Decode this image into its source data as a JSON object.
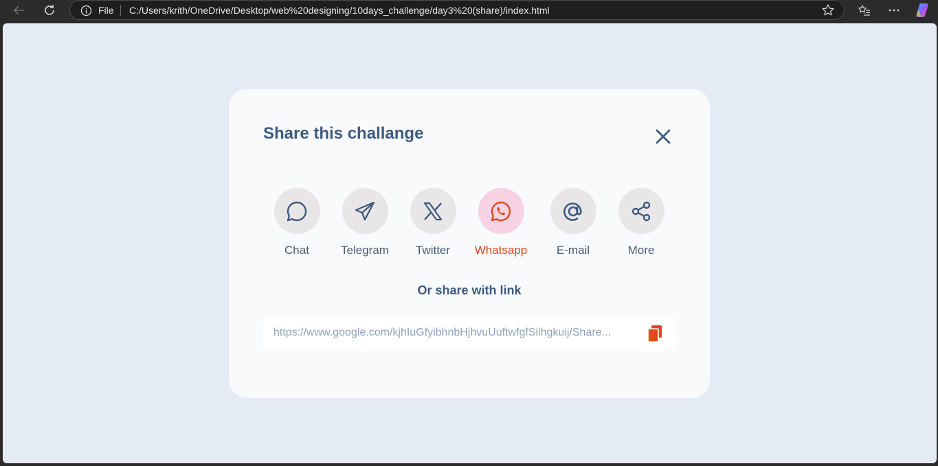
{
  "browser": {
    "file_label": "File",
    "url": "C:/Users/krith/OneDrive/Desktop/web%20designing/10days_challenge/day3%20(share)/index.html"
  },
  "dialog": {
    "title": "Share this challange",
    "share_options": [
      {
        "label": "Chat",
        "icon": "chat-icon"
      },
      {
        "label": "Telegram",
        "icon": "telegram-icon"
      },
      {
        "label": "Twitter",
        "icon": "twitter-x-icon"
      },
      {
        "label": "Whatsapp",
        "icon": "whatsapp-icon",
        "active": true
      },
      {
        "label": "E-mail",
        "icon": "at-icon"
      },
      {
        "label": "More",
        "icon": "share-icon"
      }
    ],
    "link_heading": "Or share with link",
    "link_value": "https://www.google.com/kjhIuGfyibhnbHjhvuUuftwfgfSiihgkuij/Share..."
  },
  "colors": {
    "heading": "#3d5a80",
    "accent": "#d9481c",
    "active_circle": "#f7d2e3",
    "page_bg": "#e4ebf5"
  }
}
